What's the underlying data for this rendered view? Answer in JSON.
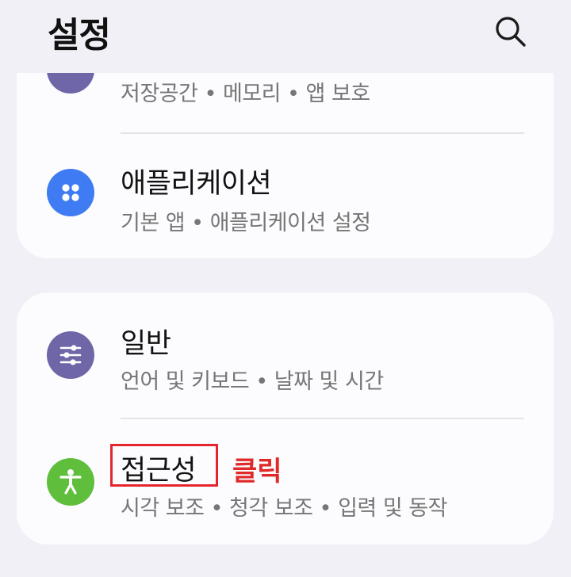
{
  "header": {
    "title": "설정"
  },
  "card1": {
    "partial_row": {
      "subtitle": "저장공간 • 메모리 • 앱 보호"
    },
    "apps_row": {
      "label": "애플리케이션",
      "subtitle": "기본 앱 • 애플리케이션 설정",
      "icon": "apps-grid-icon",
      "icon_color": "#3f7cf3"
    }
  },
  "card2": {
    "general_row": {
      "label": "일반",
      "subtitle": "언어 및 키보드 • 날짜 및 시간",
      "icon": "sliders-icon",
      "icon_color": "#6f66a8"
    },
    "accessibility_row": {
      "label": "접근성",
      "subtitle": "시각 보조 • 청각 보조 • 입력 및 동작",
      "icon": "accessibility-person-icon",
      "icon_color": "#5fbe3b"
    }
  },
  "annotation": {
    "text": "클릭",
    "color": "#e02a2a"
  }
}
